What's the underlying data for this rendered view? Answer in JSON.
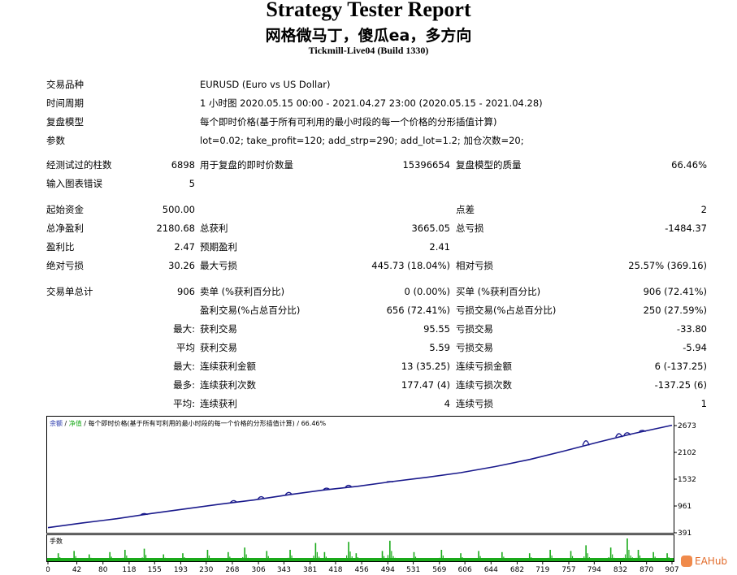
{
  "header": {
    "title": "Strategy Tester Report",
    "subtitle": "网格微马丁，傻瓜ea，多方向",
    "server": "Tickmill-Live04 (Build 1330)"
  },
  "info": {
    "symbol_label": "交易品种",
    "symbol_value": "EURUSD (Euro vs US Dollar)",
    "period_label": "时间周期",
    "period_value": "1 小时图 2020.05.15 00:00 - 2021.04.27 23:00 (2020.05.15 - 2021.04.28)",
    "model_label": "复盘模型",
    "model_value": "每个即时价格(基于所有可利用的最小时段的每一个价格的分形插值计算)",
    "params_label": "参数",
    "params_value": "lot=0.02; take_profit=120; add_strp=290; add_lot=1.2; 加仓次数=20;"
  },
  "bars": {
    "bars_label": "经测试过的柱数",
    "bars_value": "6898",
    "ticks_label": "用于复盘的即时价数量",
    "ticks_value": "15396654",
    "quality_label": "复盘模型的质量",
    "quality_value": "66.46%",
    "errors_label": "输入图表错误",
    "errors_value": "5"
  },
  "money": {
    "deposit_label": "起始资金",
    "deposit_value": "500.00",
    "spread_label": "点差",
    "spread_value": "2",
    "net_label": "总净盈利",
    "net_value": "2180.68",
    "gross_profit_label": "总获利",
    "gross_profit_value": "3665.05",
    "gross_loss_label": "总亏损",
    "gross_loss_value": "-1484.37",
    "pf_label": "盈利比",
    "pf_value": "2.47",
    "expected_label": "预期盈利",
    "expected_value": "2.41",
    "abs_dd_label": "绝对亏损",
    "abs_dd_value": "30.26",
    "max_dd_label": "最大亏损",
    "max_dd_value": "445.73 (18.04%)",
    "rel_dd_label": "相对亏损",
    "rel_dd_value": "25.57% (369.16)"
  },
  "trades": {
    "total_label": "交易单总计",
    "total_value": "906",
    "short_label": "卖单 (%获利百分比)",
    "short_value": "0 (0.00%)",
    "long_label": "买单 (%获利百分比)",
    "long_value": "906 (72.41%)",
    "profit_trades_label": "盈利交易(%占总百分比)",
    "profit_trades_value": "656 (72.41%)",
    "loss_trades_label": "亏损交易(%占总百分比)",
    "loss_trades_value": "250 (27.59%)",
    "max_prefix": "最大:",
    "avg_prefix": "平均",
    "max2_prefix": "最大:",
    "most_prefix": "最多:",
    "avg2_prefix": "平均:",
    "largest_profit_label": "获利交易",
    "largest_profit_value": "95.55",
    "largest_loss_label": "亏损交易",
    "largest_loss_value": "-33.80",
    "avg_profit_label": "获利交易",
    "avg_profit_value": "5.59",
    "avg_loss_label": "亏损交易",
    "avg_loss_value": "-5.94",
    "max_consec_profit_label": "连续获利金额",
    "max_consec_profit_value": "13 (35.25)",
    "max_consec_loss_label": "连续亏损金额",
    "max_consec_loss_value": "6 (-137.25)",
    "most_consec_profit_label": "连续获利次数",
    "most_consec_profit_value": "177.47 (4)",
    "most_consec_loss_label": "连续亏损次数",
    "most_consec_loss_value": "-137.25 (6)",
    "avg_consec_profit_label": "连续获利",
    "avg_consec_profit_value": "4",
    "avg_consec_loss_label": "连续亏损",
    "avg_consec_loss_value": "1"
  },
  "chart_data": {
    "type": "line",
    "legend": {
      "balance": "余额",
      "sep1": " / ",
      "equity": "净值",
      "sep2": " / ",
      "model": "每个即时价格(基于所有可利用的最小时段的每一个价格的分形插值计算)",
      "sep3": " / ",
      "quality": "66.46%"
    },
    "volume_label": "手数",
    "y_ticks": [
      "2673",
      "2102",
      "1532",
      "961",
      "391"
    ],
    "ylim": [
      391,
      2673
    ],
    "x_ticks": [
      "0",
      "42",
      "80",
      "118",
      "155",
      "193",
      "230",
      "268",
      "306",
      "343",
      "381",
      "418",
      "456",
      "494",
      "531",
      "569",
      "606",
      "644",
      "682",
      "719",
      "757",
      "794",
      "832",
      "870",
      "907"
    ],
    "xlim": [
      0,
      907
    ],
    "series": [
      {
        "x": [
          0,
          50,
          100,
          150,
          200,
          250,
          300,
          350,
          400,
          450,
          500,
          550,
          600,
          650,
          700,
          750,
          800,
          850,
          907
        ],
        "values": [
          500,
          600,
          690,
          800,
          900,
          1000,
          1090,
          1200,
          1300,
          1380,
          1480,
          1570,
          1670,
          1800,
          1950,
          2130,
          2320,
          2500,
          2680
        ]
      }
    ],
    "equity_spikes": [
      {
        "x": 140,
        "value": 800
      },
      {
        "x": 270,
        "value": 1075
      },
      {
        "x": 310,
        "value": 1160
      },
      {
        "x": 350,
        "value": 1250
      },
      {
        "x": 405,
        "value": 1340
      },
      {
        "x": 437,
        "value": 1400
      },
      {
        "x": 497,
        "value": 1480
      },
      {
        "x": 782,
        "value": 2350
      },
      {
        "x": 830,
        "value": 2500
      },
      {
        "x": 842,
        "value": 2520
      },
      {
        "x": 864,
        "value": 2570
      }
    ],
    "volume_peaks": [
      {
        "x": 15,
        "value": 0.35
      },
      {
        "x": 38,
        "value": 0.45
      },
      {
        "x": 60,
        "value": 0.3
      },
      {
        "x": 90,
        "value": 0.4
      },
      {
        "x": 112,
        "value": 0.5
      },
      {
        "x": 140,
        "value": 0.55
      },
      {
        "x": 168,
        "value": 0.3
      },
      {
        "x": 196,
        "value": 0.35
      },
      {
        "x": 232,
        "value": 0.5
      },
      {
        "x": 262,
        "value": 0.4
      },
      {
        "x": 286,
        "value": 0.6
      },
      {
        "x": 318,
        "value": 0.45
      },
      {
        "x": 352,
        "value": 0.5
      },
      {
        "x": 389,
        "value": 0.8
      },
      {
        "x": 402,
        "value": 0.4
      },
      {
        "x": 437,
        "value": 0.85
      },
      {
        "x": 448,
        "value": 0.35
      },
      {
        "x": 486,
        "value": 0.45
      },
      {
        "x": 497,
        "value": 0.9
      },
      {
        "x": 532,
        "value": 0.4
      },
      {
        "x": 572,
        "value": 0.5
      },
      {
        "x": 600,
        "value": 0.35
      },
      {
        "x": 626,
        "value": 0.45
      },
      {
        "x": 660,
        "value": 0.4
      },
      {
        "x": 700,
        "value": 0.35
      },
      {
        "x": 730,
        "value": 0.5
      },
      {
        "x": 760,
        "value": 0.45
      },
      {
        "x": 782,
        "value": 0.7
      },
      {
        "x": 818,
        "value": 0.6
      },
      {
        "x": 842,
        "value": 1.0
      },
      {
        "x": 858,
        "value": 0.5
      },
      {
        "x": 880,
        "value": 0.4
      },
      {
        "x": 900,
        "value": 0.35
      }
    ],
    "colors": {
      "balance": "#1a1a8c",
      "volume": "#1aaa1a",
      "axis": "#000000",
      "legend": "#2233aa"
    }
  },
  "watermark": {
    "text": "EAHub"
  }
}
